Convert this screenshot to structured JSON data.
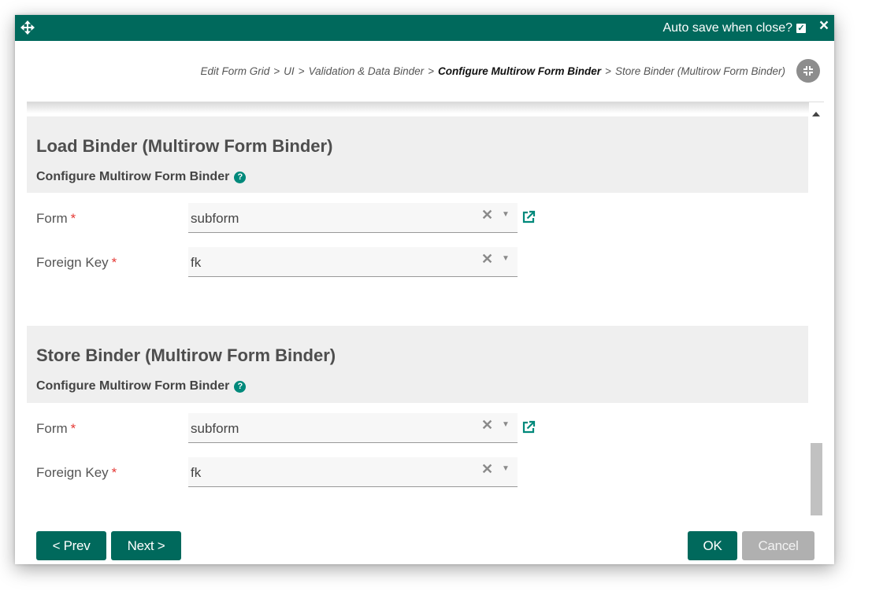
{
  "titlebar": {
    "autosave_label": "Auto save when close?",
    "autosave_checked": true,
    "close_glyph": "×"
  },
  "breadcrumb": {
    "items": [
      "Edit Form Grid",
      "UI",
      "Validation & Data Binder",
      "Configure Multirow Form Binder",
      "Store Binder (Multirow Form Binder)"
    ],
    "current_index": 3,
    "separator": ">"
  },
  "load_binder": {
    "title": "Load Binder (Multirow Form Binder)",
    "subtitle": "Configure Multirow Form Binder",
    "help_glyph": "?",
    "fields": [
      {
        "label": "Form",
        "required_mark": "*",
        "value": "subform",
        "has_link": true
      },
      {
        "label": "Foreign Key",
        "required_mark": "*",
        "value": "fk",
        "has_link": false
      }
    ]
  },
  "store_binder": {
    "title": "Store Binder (Multirow Form Binder)",
    "subtitle": "Configure Multirow Form Binder",
    "help_glyph": "?",
    "fields": [
      {
        "label": "Form",
        "required_mark": "*",
        "value": "subform",
        "has_link": true
      },
      {
        "label": "Foreign Key",
        "required_mark": "*",
        "value": "fk",
        "has_link": false
      }
    ]
  },
  "select_glyphs": {
    "clear": "✕",
    "caret": "▼"
  },
  "footer": {
    "prev_label": "< Prev",
    "next_label": "Next >",
    "ok_label": "OK",
    "cancel_label": "Cancel"
  },
  "colors": {
    "primary": "#00695c",
    "help": "#00897b",
    "required": "#e53935",
    "disabled_button": "#b0b0b0",
    "section_background": "#efefef"
  },
  "icons": {
    "move": "move-icon",
    "autosave_check": "checkbox-icon",
    "close": "close-icon",
    "collapse": "collapse-icon",
    "help": "help-icon",
    "external_link": "external-link-icon",
    "clear": "clear-icon",
    "caret": "caret-down-icon"
  }
}
